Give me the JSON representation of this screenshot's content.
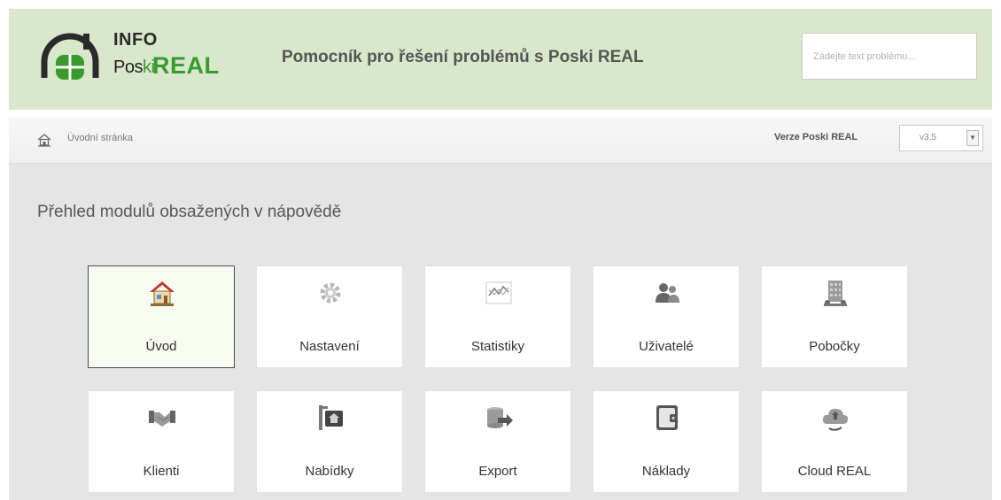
{
  "header": {
    "logo_info": "INFO",
    "logo_poski_pre": "Pos",
    "logo_poski_ki": "ki",
    "logo_real": "REAL",
    "title": "Pomocník pro řešení problémů s Poski REAL",
    "search_placeholder": "Zadejte text problému..."
  },
  "breadcrumb": {
    "home": "Úvodní stránka",
    "version_label": "Verze Poski REAL",
    "version_value": "v3.5"
  },
  "main": {
    "title": "Přehled modulů obsažených v nápovědě",
    "modules": [
      {
        "label": "Úvod",
        "icon": "home-icon",
        "active": true
      },
      {
        "label": "Nastavení",
        "icon": "gear-icon"
      },
      {
        "label": "Statistiky",
        "icon": "chart-icon"
      },
      {
        "label": "Uživatelé",
        "icon": "users-icon"
      },
      {
        "label": "Pobočky",
        "icon": "building-icon"
      },
      {
        "label": "Klienti",
        "icon": "handshake-icon"
      },
      {
        "label": "Nabídky",
        "icon": "sign-icon"
      },
      {
        "label": "Export",
        "icon": "export-icon"
      },
      {
        "label": "Náklady",
        "icon": "wallet-icon"
      },
      {
        "label": "Cloud REAL",
        "icon": "cloud-icon"
      }
    ]
  },
  "colors": {
    "header_bg": "#d9e8cc",
    "brand_green": "#3a9a2e",
    "main_bg": "#e5e5e5"
  }
}
